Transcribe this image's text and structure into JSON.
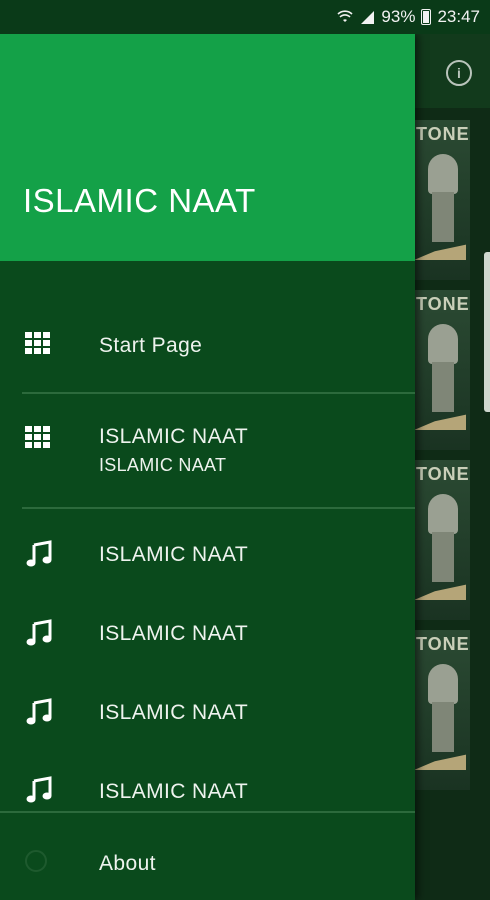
{
  "status_bar": {
    "battery": "93%",
    "time": "23:47",
    "icons": [
      "wifi-icon",
      "signal-icon",
      "battery-icon"
    ]
  },
  "drawer": {
    "title": "ISLAMIC NAAT",
    "items": [
      {
        "label": "Start Page",
        "icon": "grid-icon"
      },
      {
        "label": "ISLAMIC NAAT",
        "sublabel": "ISLAMIC NAAT",
        "icon": "grid-icon"
      },
      {
        "label": "ISLAMIC NAAT",
        "icon": "music-note-icon"
      },
      {
        "label": "ISLAMIC NAAT",
        "icon": "music-note-icon"
      },
      {
        "label": "ISLAMIC NAAT",
        "icon": "music-note-icon"
      },
      {
        "label": "ISLAMIC NAAT",
        "icon": "music-note-icon"
      }
    ],
    "footer": {
      "label": "About",
      "icon": "info-icon"
    }
  },
  "background_app": {
    "tile_text": "TONE",
    "toolbar_icon": "info-icon"
  },
  "colors": {
    "header": "#14a148",
    "drawer_bg": "#0a4a1c",
    "status_bar": "#0a3a18"
  }
}
